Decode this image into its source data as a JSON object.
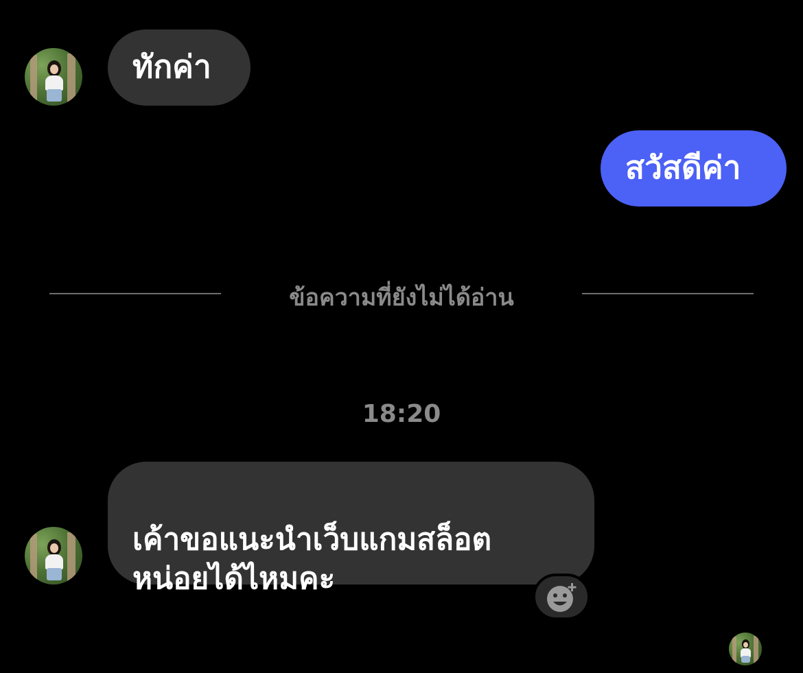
{
  "messages": [
    {
      "direction": "incoming",
      "text": "ทักค่า"
    },
    {
      "direction": "outgoing",
      "text": "สวัสดีค่า"
    },
    {
      "direction": "incoming",
      "text": "เค้าขอแนะนำเว็บแกมสล็อต\nหน่อยได้ไหมคะ"
    }
  ],
  "unread_divider": {
    "label": "ข้อความที่ยังไม่ได้อ่าน"
  },
  "timestamp": "18:20",
  "colors": {
    "background": "#000000",
    "incoming_bubble": "#333333",
    "outgoing_bubble": "#4c61f5",
    "muted_text": "#8a8a8a"
  },
  "icons": {
    "reaction": "add-reaction-smiley-icon",
    "avatar": "contact-avatar-photo"
  }
}
